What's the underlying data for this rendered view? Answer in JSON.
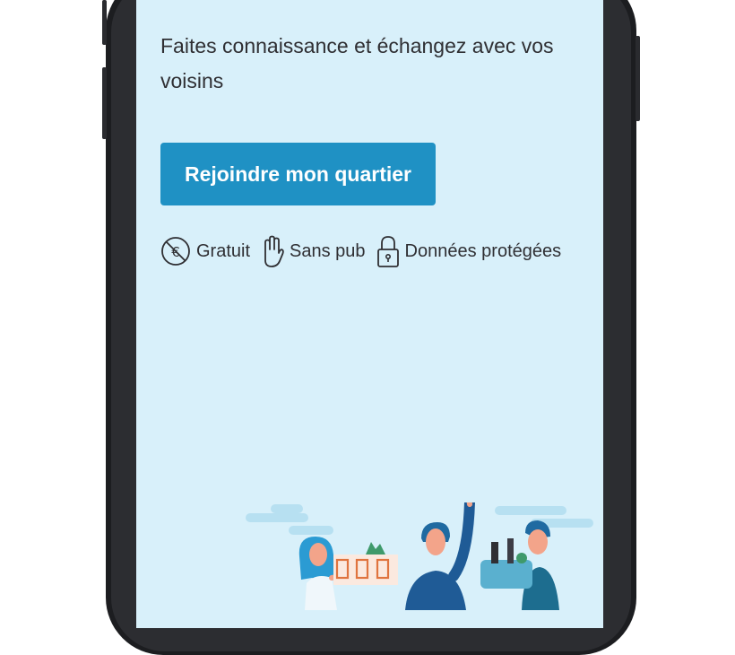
{
  "hero": {
    "headline": "Faites connaissance et échangez avec vos voisins",
    "cta_label": "Rejoindre mon quartier"
  },
  "features": [
    {
      "label": "Gratuit",
      "icon": "no-euro-icon"
    },
    {
      "label": "Sans pub",
      "icon": "hand-icon"
    },
    {
      "label": "Données protégées",
      "icon": "lock-icon"
    }
  ],
  "colors": {
    "screen_background": "#d8f0fa",
    "cta_background": "#1f91c4",
    "cta_text": "#ffffff",
    "text": "#2f2f33",
    "phone_frame": "#1c1d20"
  }
}
